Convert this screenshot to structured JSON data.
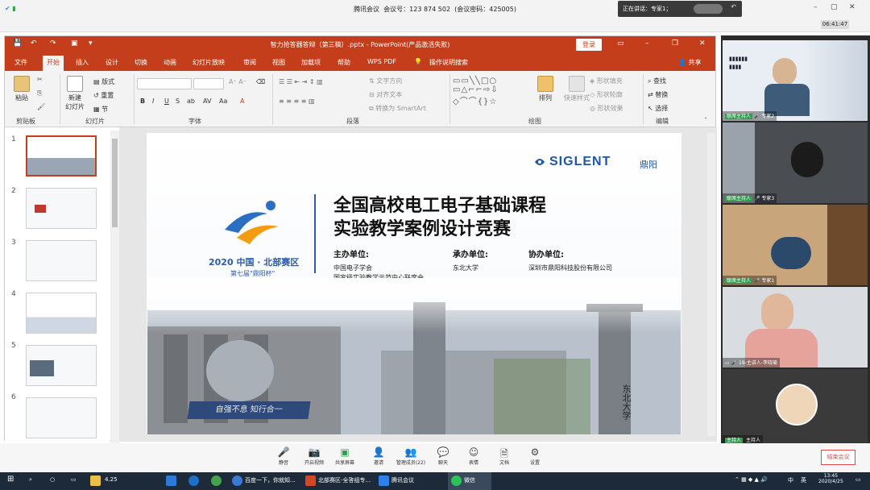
{
  "meeting": {
    "title": "腾讯会议",
    "id_text": "会议号：123 874 502",
    "pwd_text": "(会议密码：425005)",
    "speaking": "正在讲话：专家1；",
    "time": "06:41:47"
  },
  "ppt": {
    "title": "智力抢答器答辩（第三稿）.pptx - PowerPoint(产品激活失败)",
    "login": "登录",
    "share": "共享",
    "tabs": [
      "文件",
      "开始",
      "插入",
      "设计",
      "切换",
      "动画",
      "幻灯片放映",
      "审阅",
      "视图",
      "加载项",
      "帮助",
      "WPS PDF",
      "操作说明搜索"
    ],
    "ribbon": {
      "paste": "粘贴",
      "clipboard": "剪贴板",
      "new_slide": "新建\n幻灯片",
      "layout": "版式",
      "reset": "重置",
      "section": "节",
      "slides": "幻灯片",
      "font": "字体",
      "paragraph": "段落",
      "text_dir": "文字方向",
      "align_text": "对齐文本",
      "smartart": "转换为 SmartArt",
      "arrange": "排列",
      "quick_style": "快速样式",
      "fill": "形状填充",
      "outline": "形状轮廓",
      "effects": "形状效果",
      "drawing": "绘图",
      "find": "查找",
      "replace": "替换",
      "select": "选择",
      "editing": "编辑"
    },
    "slide_numbers": [
      "1",
      "2",
      "3",
      "4",
      "5",
      "6"
    ]
  },
  "slide": {
    "brand": "SIGLENT",
    "brand_cn": "鼎阳",
    "title1": "全国高校电工电子基础课程",
    "title2": "实验教学案例设计竞赛",
    "region": "2020 中国 · 北部赛区",
    "cup": "第七届\"鼎阳杯\"",
    "host_label": "主办单位:",
    "host1": "中国电子学会",
    "host2": "国家级实验教学示范中心联席会",
    "undertake_label": "承办单位:",
    "undertake": "东北大学",
    "co_label": "协办单位:",
    "co": "深圳市鼎阳科技股份有限公司",
    "motto": "自强不息  知行合一",
    "plaque": "东北大学"
  },
  "videos": [
    {
      "role": "联席主持人",
      "name": "专家2"
    },
    {
      "role": "联席主持人",
      "name": "专家3"
    },
    {
      "role": "联席主持人",
      "name": "专家1"
    },
    {
      "role": "",
      "name": "19-主讲人-李晓瑜"
    },
    {
      "role": "主持人",
      "name": "主持人"
    }
  ],
  "toolbar": {
    "items": [
      "静音",
      "开启视频",
      "共享屏幕",
      "邀请",
      "管理成员(22)",
      "聊天",
      "表情",
      "文档",
      "设置"
    ],
    "end": "结束会议"
  },
  "taskbar": {
    "items": [
      "4.25",
      "百度一下，你就知...",
      "北部赛区-全答组专...",
      "腾讯会议",
      "微信"
    ],
    "tray": [
      "中",
      "英"
    ],
    "time": "13:45",
    "date": "2020/4/25"
  }
}
